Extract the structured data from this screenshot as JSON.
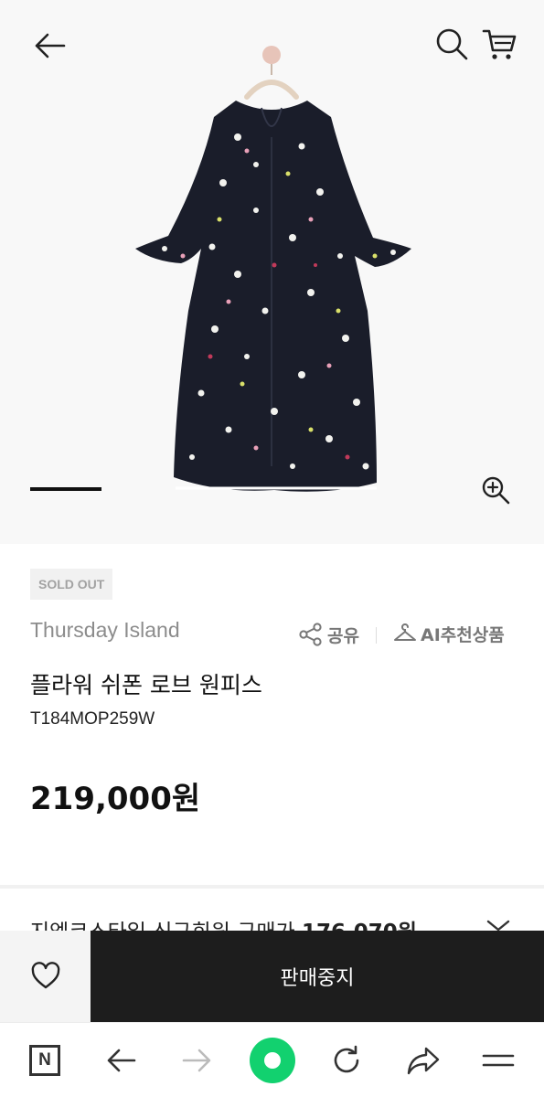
{
  "header": {
    "back_icon": "arrow-left-icon",
    "search_icon": "search-icon",
    "cart_icon": "cart-icon"
  },
  "gallery": {
    "zoom_icon": "zoom-in-icon",
    "dress_colors": {
      "fabric": "#1a1d2a",
      "flower_1": "#f2f2ee",
      "flower_2": "#e8a0b8",
      "flower_3": "#d9e06a",
      "flower_4": "#c13a5a"
    }
  },
  "product": {
    "badge": "SOLD OUT",
    "brand": "Thursday Island",
    "share_label": "공유",
    "ai_label": "AI추천상품",
    "name": "플라워 쉬폰 로브 원피스",
    "code": "T184MOP259W",
    "price": "219,000원"
  },
  "member": {
    "prefix": "지엠코스타일 신규회원 구매가 ",
    "price": "176,070원"
  },
  "buybar": {
    "wish_icon": "heart-icon",
    "stop_label": "판매중지",
    "colors": {
      "stop_bg": "#1d1d1d",
      "wish_bg": "#f4f4f4"
    }
  },
  "browser_nav": {
    "home_label": "N",
    "accent": "#12d16f"
  }
}
